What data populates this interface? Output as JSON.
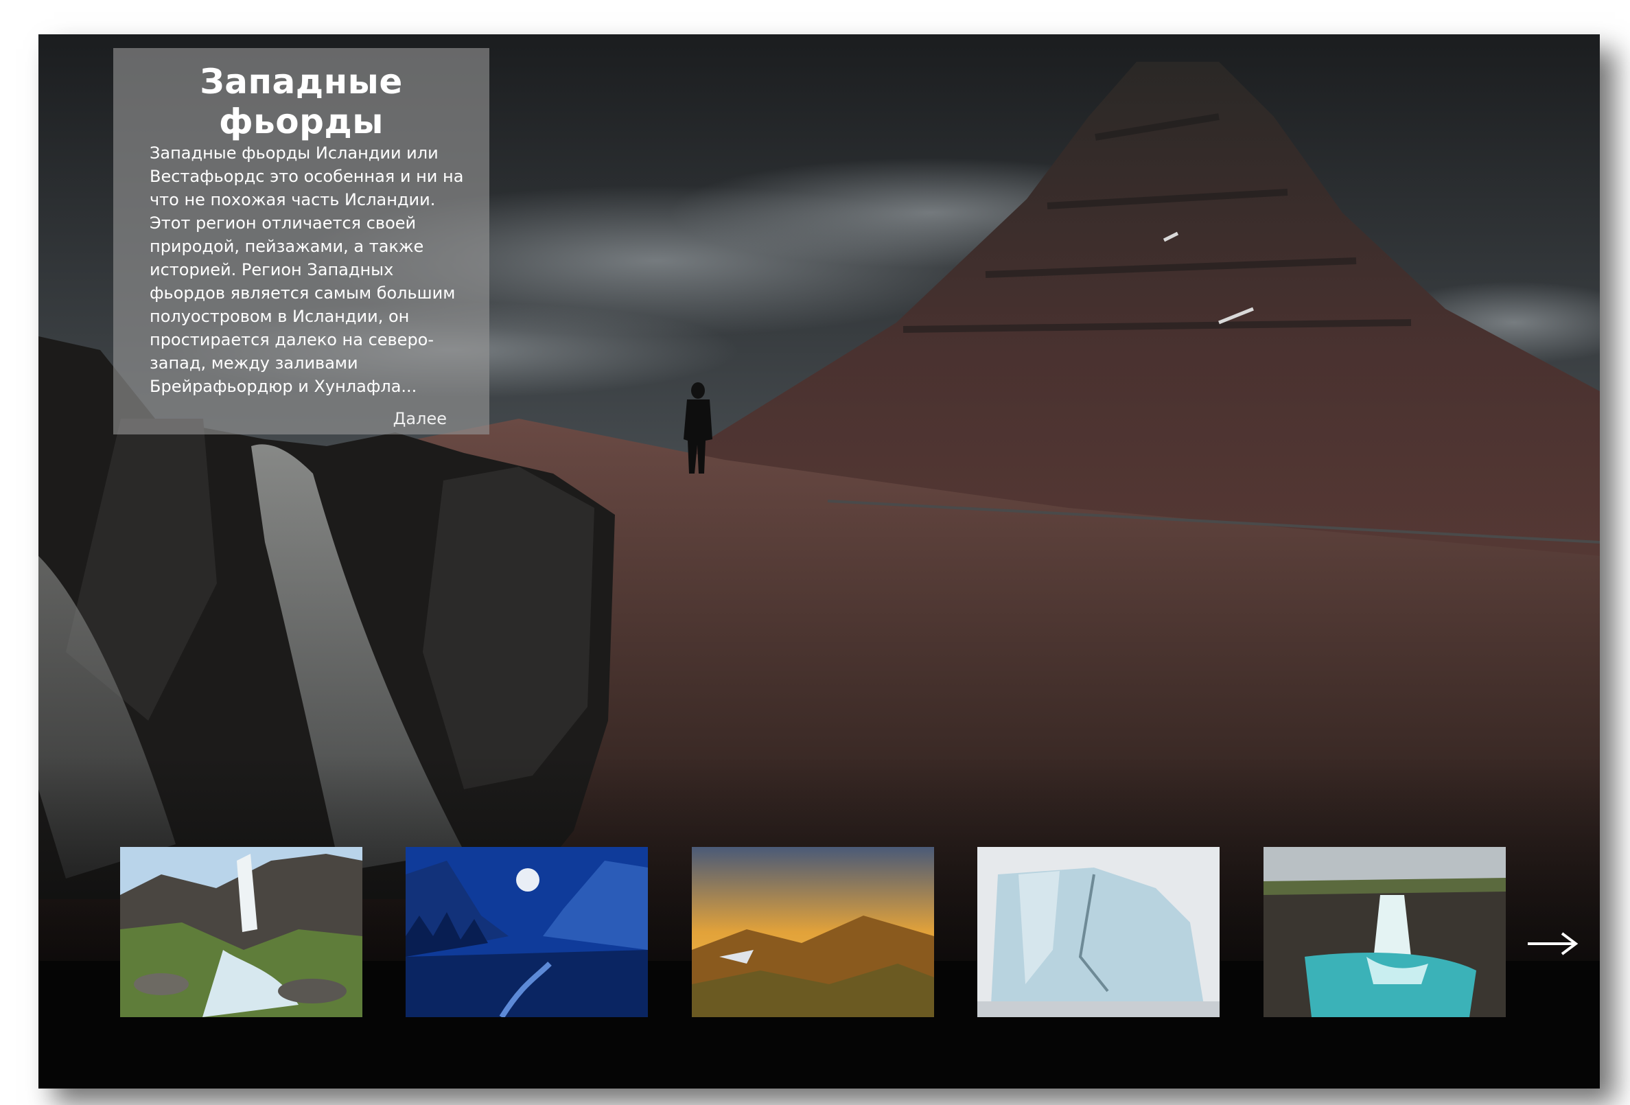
{
  "info": {
    "title": "Западные фьорды",
    "text": "Западные фьорды Исландии или Вестафьордс это особенная и ни на что не похожая часть Исландии. Этот регион отличается своей природой, пейзажами, а также историей. Регион Западных фьордов является самым большим полуостровом в Исландии, он простирается далеко на северо-запад, между заливами Брейрафьордюр и Хунлафла...",
    "more_label": "Далее"
  },
  "thumbnails": [
    {
      "icon": "waterfall-canyon"
    },
    {
      "icon": "blue-moon-valley"
    },
    {
      "icon": "sunset-hills"
    },
    {
      "icon": "iceberg"
    },
    {
      "icon": "turquoise-waterfall"
    }
  ],
  "navigation": {
    "next_icon": "arrow-right-icon"
  },
  "colors": {
    "panel": "#969696",
    "frame": "#050505",
    "text": "#ffffff"
  }
}
